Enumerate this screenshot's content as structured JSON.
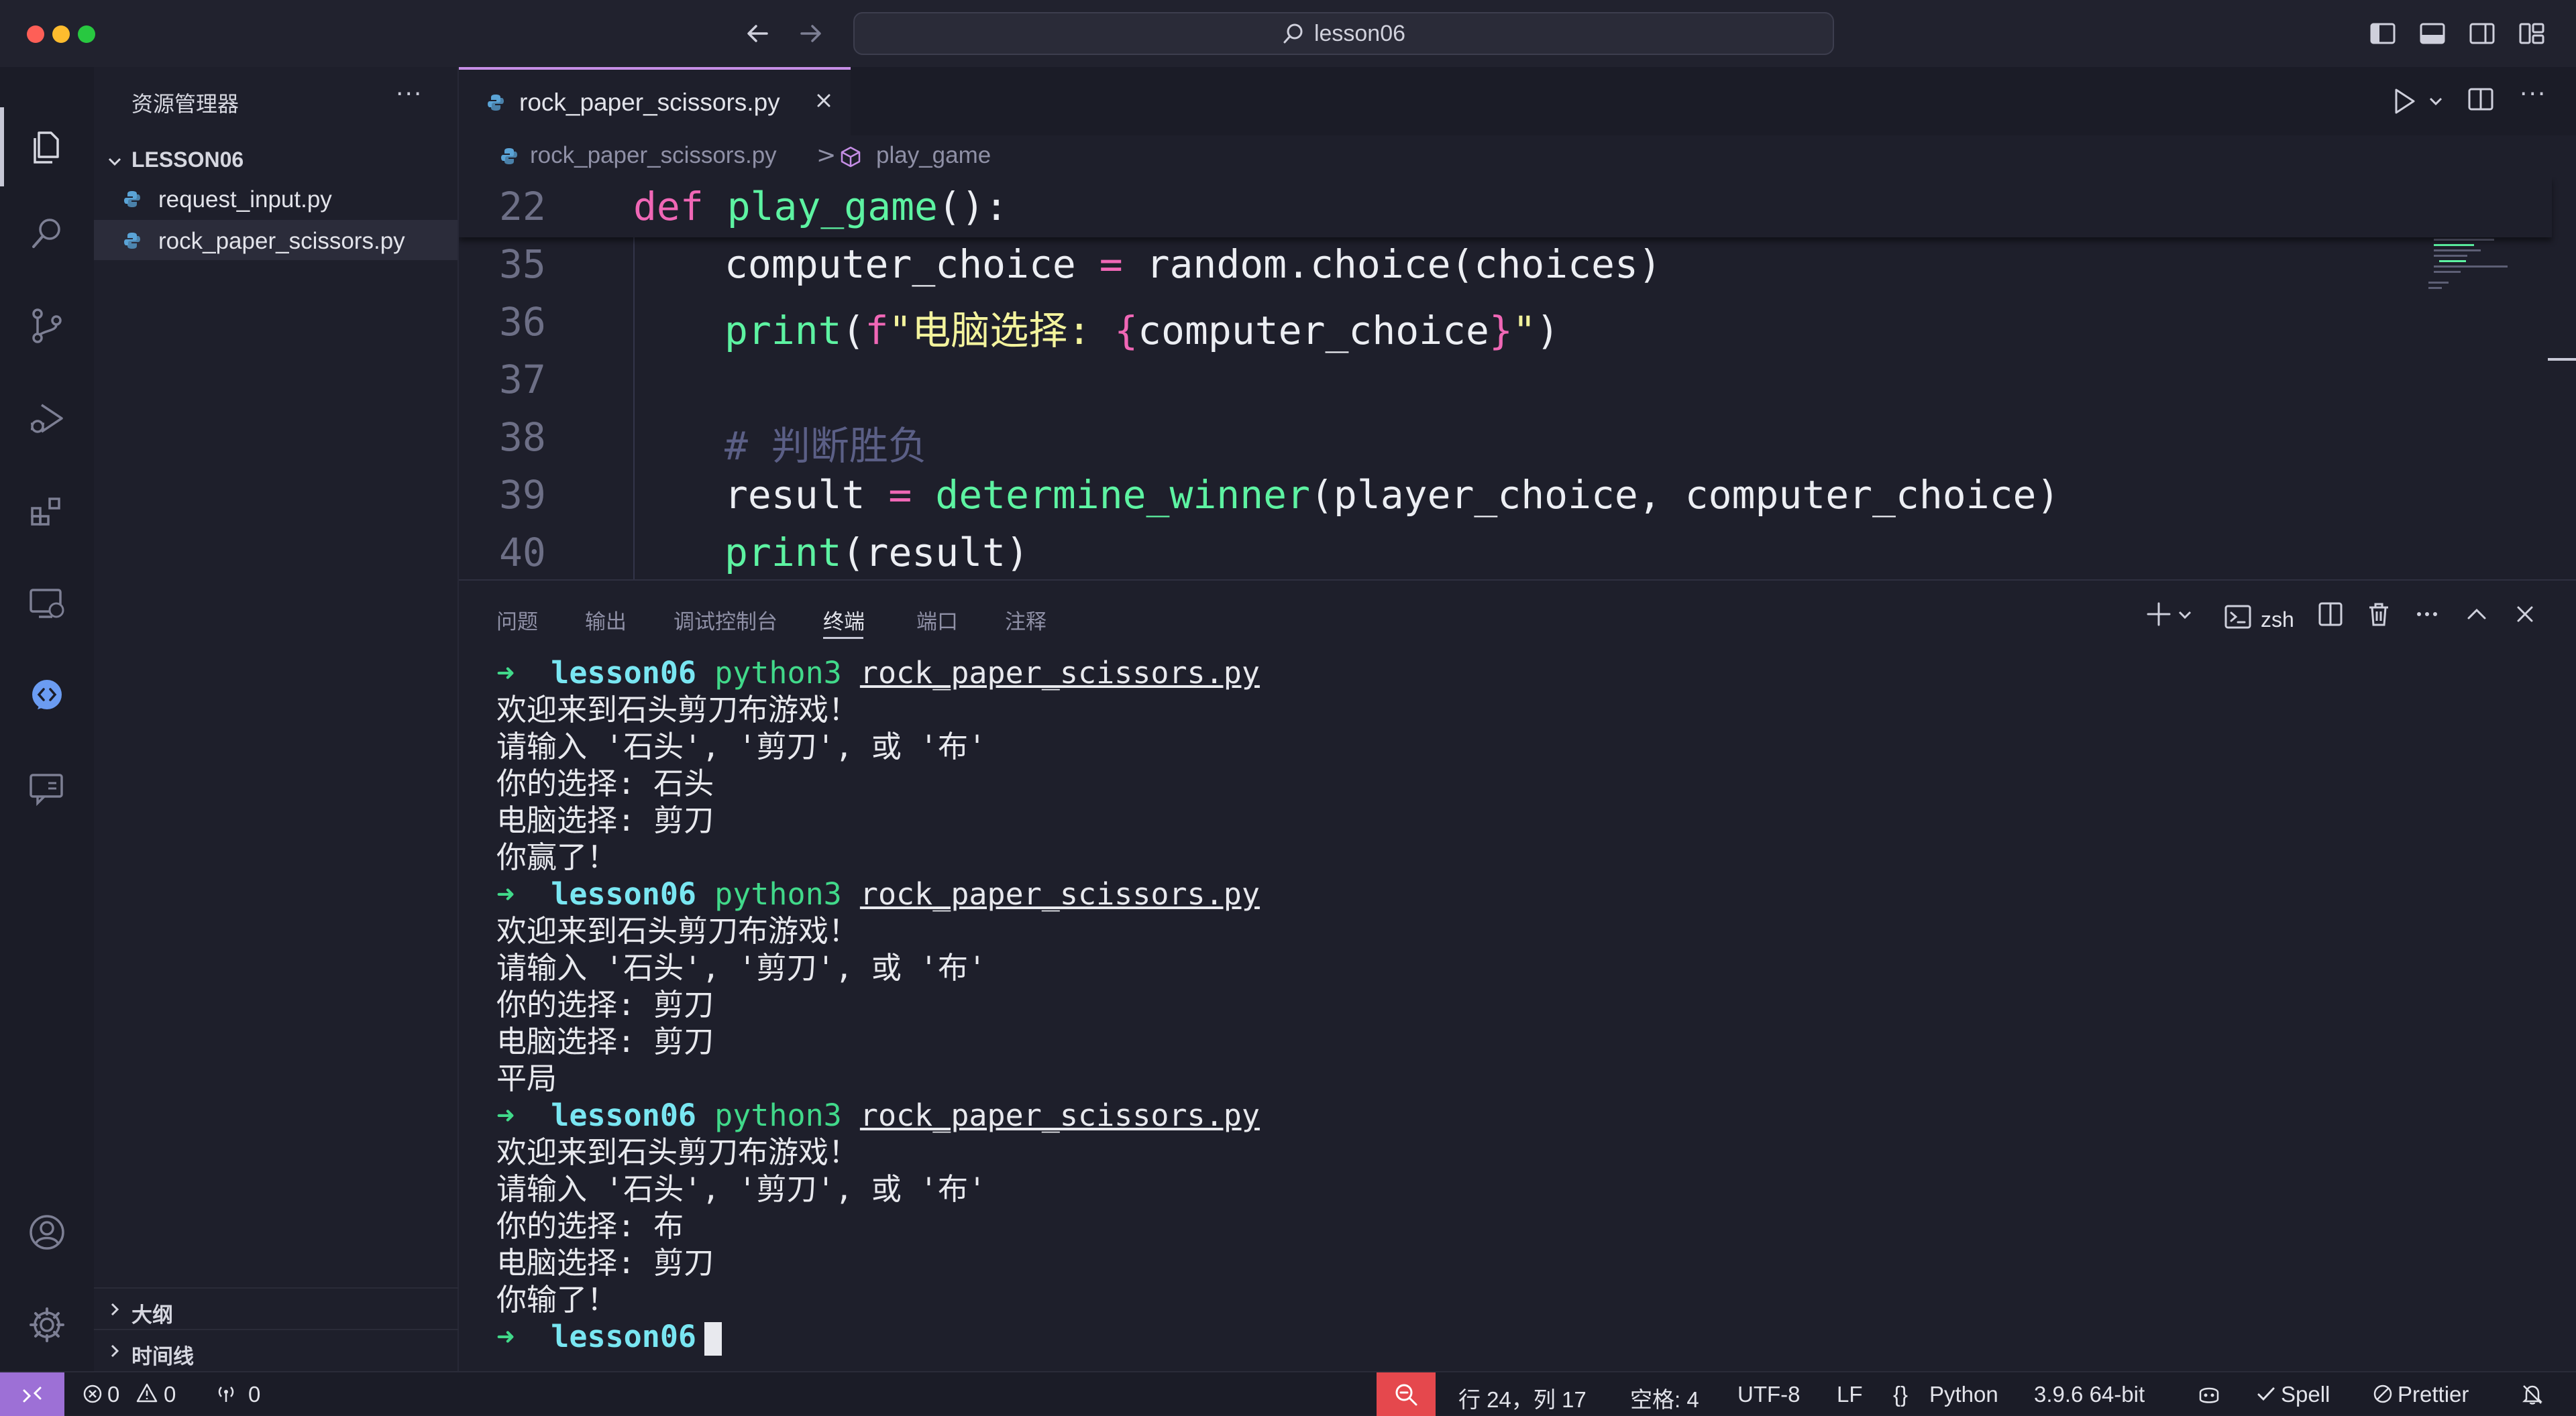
{
  "window": {
    "title": "lesson06"
  },
  "sidebar": {
    "title": "资源管理器",
    "more": "···",
    "folder": "LESSON06",
    "files": [
      "request_input.py",
      "rock_paper_scissors.py"
    ],
    "outline": "大纲",
    "timeline": "时间线"
  },
  "editor": {
    "tab": "rock_paper_scissors.py",
    "more": "···",
    "breadcrumb": {
      "file": "rock_paper_scissors.py",
      "sep": ">",
      "symbol": "play_game"
    },
    "sticky": {
      "line": "22",
      "kw": "def",
      "name": "play_game",
      "rest": "():"
    },
    "lines": [
      {
        "n": "35",
        "var": "computer_choice",
        "op": " = ",
        "call": "random.choice(choices)"
      },
      {
        "n": "36",
        "fn": "print",
        "open": "(",
        "fpre": "f",
        "str1": "\"电脑选择: ",
        "lb": "{",
        "expr": "computer_choice",
        "rb": "}",
        "str2": "\"",
        "close": ")"
      },
      {
        "n": "37"
      },
      {
        "n": "38",
        "comment": "# 判断胜负"
      },
      {
        "n": "39",
        "var": "result",
        "op": " = ",
        "fn": "determine_winner",
        "args": "(player_choice, computer_choice)"
      },
      {
        "n": "40",
        "fn": "print",
        "args": "(result)"
      }
    ]
  },
  "panel": {
    "tabs": [
      "问题",
      "输出",
      "调试控制台",
      "终端",
      "端口",
      "注释"
    ],
    "active_tab": "终端",
    "shell": "zsh",
    "terminal": {
      "arrow": "➜",
      "dir": "lesson06",
      "exe": "python3",
      "file": "rock_paper_scissors.py",
      "runs": [
        [
          "欢迎来到石头剪刀布游戏！",
          "请输入 '石头', '剪刀', 或 '布'",
          "你的选择: 石头",
          "电脑选择: 剪刀",
          "你赢了！"
        ],
        [
          "欢迎来到石头剪刀布游戏！",
          "请输入 '石头', '剪刀', 或 '布'",
          "你的选择: 剪刀",
          "电脑选择: 剪刀",
          "平局"
        ],
        [
          "欢迎来到石头剪刀布游戏！",
          "请输入 '石头', '剪刀', 或 '布'",
          "你的选择: 布",
          "电脑选择: 剪刀",
          "你输了！"
        ]
      ]
    }
  },
  "status": {
    "errors": "0",
    "warnings": "0",
    "ports": "0",
    "position": "行 24，列 17",
    "spaces": "空格: 4",
    "encoding": "UTF-8",
    "eol": "LF",
    "language_braces": "{}",
    "language": "Python",
    "interpreter": "3.9.6 64-bit",
    "spell": "Spell",
    "prettier": "Prettier"
  },
  "colors": {
    "accent": "#c68ee6",
    "remote": "#9d70d6",
    "zoom": "#e5484d"
  }
}
